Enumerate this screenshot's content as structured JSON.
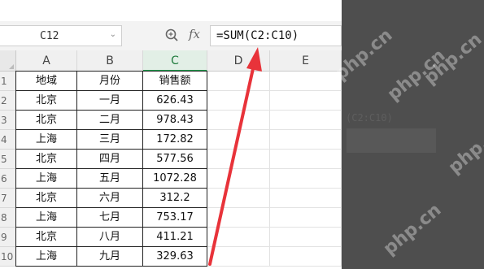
{
  "namebox": {
    "value": "C12",
    "dropdown_glyph": "⌄"
  },
  "toolbar": {
    "zoom_icon": "magnifier-zoom-icon",
    "fx_label": "fx"
  },
  "formula": {
    "value": "=SUM(C2:C10)"
  },
  "columns": [
    "A",
    "B",
    "C",
    "D",
    "E"
  ],
  "rows": [
    "1",
    "2",
    "3",
    "4",
    "5",
    "6",
    "7",
    "8",
    "9",
    "10"
  ],
  "table": {
    "header": [
      "地域",
      "月份",
      "销售额"
    ],
    "data": [
      [
        "北京",
        "一月",
        "626.43"
      ],
      [
        "北京",
        "二月",
        "978.43"
      ],
      [
        "上海",
        "三月",
        "172.82"
      ],
      [
        "北京",
        "四月",
        "577.56"
      ],
      [
        "上海",
        "五月",
        "1072.28"
      ],
      [
        "北京",
        "六月",
        "312.2"
      ],
      [
        "上海",
        "七月",
        "753.17"
      ],
      [
        "北京",
        "八月",
        "411.21"
      ],
      [
        "上海",
        "九月",
        "329.63"
      ]
    ]
  },
  "overlay": {
    "ghost_text": "(C2:C10)",
    "watermark": "php.cn"
  },
  "colors": {
    "active_col": "#1e9e4d",
    "arrow": "#e8333a",
    "overlay": "#4e4e4e"
  }
}
